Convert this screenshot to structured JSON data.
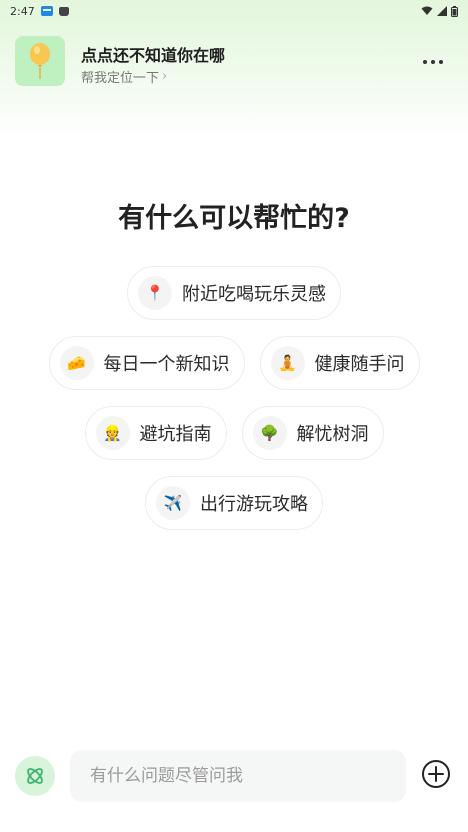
{
  "status_bar": {
    "time": "2:47",
    "icons": [
      "app-notification-icon",
      "cat-icon",
      "wifi-icon",
      "signal-icon",
      "battery-icon"
    ]
  },
  "header": {
    "title": "点点还不知道你在哪",
    "subtitle": "帮我定位一下",
    "subtitle_arrow": "›",
    "avatar_icon": "balloon-icon",
    "more_icon": "more-dots-icon"
  },
  "main": {
    "title": "有什么可以帮忙的?"
  },
  "suggestions": [
    {
      "label": "附近吃喝玩乐灵感",
      "icon": "location-pin-icon",
      "glyph": "📍"
    },
    {
      "label": "每日一个新知识",
      "icon": "cheese-icon",
      "glyph": "🧀"
    },
    {
      "label": "健康随手问",
      "icon": "meditation-icon",
      "glyph": "🧘"
    },
    {
      "label": "避坑指南",
      "icon": "construction-worker-icon",
      "glyph": "👷"
    },
    {
      "label": "解忧树洞",
      "icon": "tree-icon",
      "glyph": "🌳"
    },
    {
      "label": "出行游玩攻略",
      "icon": "airplane-icon",
      "glyph": "✈️"
    }
  ],
  "input": {
    "placeholder": "有什么问题尽管问我",
    "value": ""
  },
  "bottom_icons": {
    "assistant": "assistant-icon",
    "add": "add-circle-icon"
  },
  "colors": {
    "header_gradient_top": "#e3f6dc",
    "avatar_bg": "#bff0c0",
    "assistant_bg": "#d8f4da",
    "accent_green": "#3fb36f",
    "balloon": "#f9c74f"
  }
}
